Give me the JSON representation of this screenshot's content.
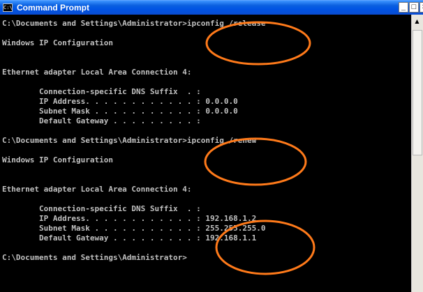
{
  "window": {
    "title": "Command Prompt",
    "icon": "console-icon",
    "icon_text": "C:\\",
    "controls": {
      "minimize": "_",
      "maximize": "□",
      "close": "×"
    }
  },
  "console": {
    "text_color": "#c0c0c0",
    "background_color": "#000000",
    "lines": [
      "C:\\Documents and Settings\\Administrator>ipconfig /release",
      "",
      "Windows IP Configuration",
      "",
      "",
      "Ethernet adapter Local Area Connection 4:",
      "",
      "        Connection-specific DNS Suffix  . :",
      "        IP Address. . . . . . . . . . . . : 0.0.0.0",
      "        Subnet Mask . . . . . . . . . . . : 0.0.0.0",
      "        Default Gateway . . . . . . . . . :",
      "",
      "C:\\Documents and Settings\\Administrator>ipconfig /renew",
      "",
      "Windows IP Configuration",
      "",
      "",
      "Ethernet adapter Local Area Connection 4:",
      "",
      "        Connection-specific DNS Suffix  . :",
      "        IP Address. . . . . . . . . . . . : 192.168.1.2",
      "        Subnet Mask . . . . . . . . . . . : 255.255.255.0",
      "        Default Gateway . . . . . . . . . : 192.168.1.1",
      "",
      "C:\\Documents and Settings\\Administrator>"
    ]
  },
  "scrollbar": {
    "up_arrow": "▲"
  },
  "annotations": {
    "stroke_color": "#ff7a1a",
    "shape": "ellipse",
    "count": 3
  }
}
